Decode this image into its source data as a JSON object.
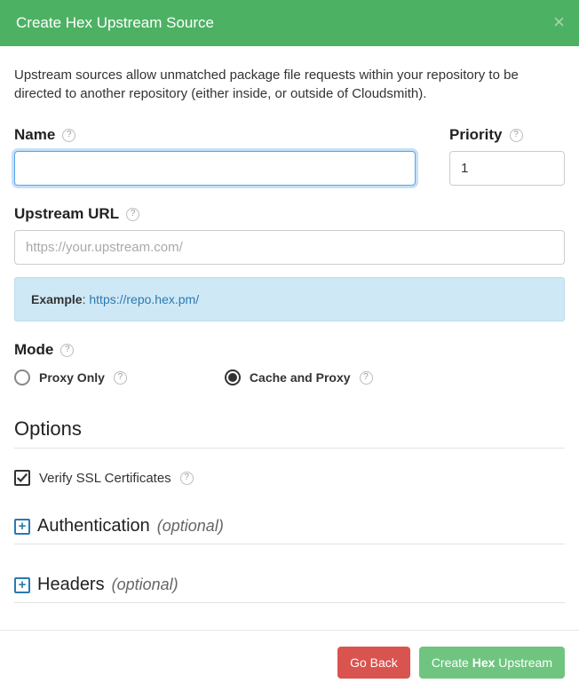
{
  "header": {
    "title": "Create Hex Upstream Source",
    "close": "×"
  },
  "description": "Upstream sources allow unmatched package file requests within your repository to be directed to another repository (either inside, or outside of Cloudsmith).",
  "fields": {
    "name": {
      "label": "Name",
      "value": ""
    },
    "priority": {
      "label": "Priority",
      "value": "1"
    },
    "url": {
      "label": "Upstream URL",
      "placeholder": "https://your.upstream.com/",
      "value": ""
    },
    "mode": {
      "label": "Mode",
      "options": {
        "proxy_only": {
          "label": "Proxy Only",
          "selected": false
        },
        "cache_proxy": {
          "label": "Cache and Proxy",
          "selected": true
        }
      }
    }
  },
  "example": {
    "prefix": "Example",
    "link_text": "https://repo.hex.pm/"
  },
  "options": {
    "heading": "Options",
    "verify_ssl": {
      "label": "Verify SSL Certificates",
      "checked": true
    }
  },
  "sections": {
    "auth": {
      "title": "Authentication",
      "optional": "(optional)"
    },
    "headers": {
      "title": "Headers",
      "optional": "(optional)"
    }
  },
  "footer": {
    "back": "Go Back",
    "create_prefix": "Create ",
    "create_bold": "Hex",
    "create_suffix": " Upstream"
  }
}
